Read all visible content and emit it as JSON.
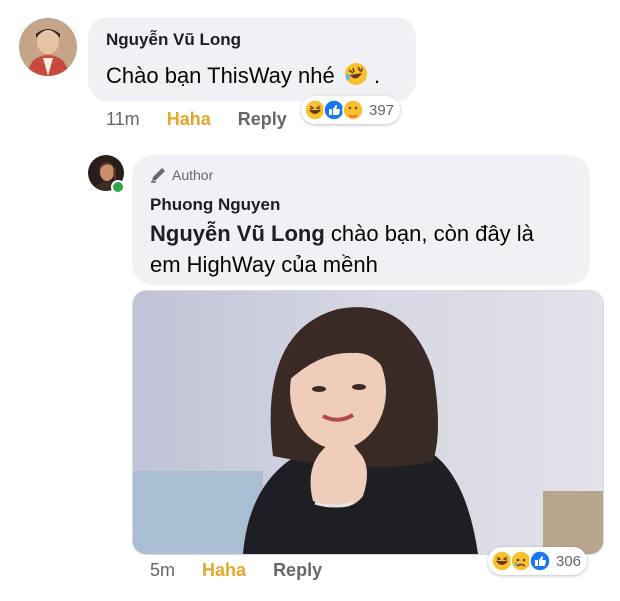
{
  "comment1": {
    "author": "Nguyễn Vũ Long",
    "text": "Chào bạn ThisWay nhé",
    "text_suffix": ".",
    "time": "11m",
    "reaction_label": "Haha",
    "reply_label": "Reply",
    "reaction_count": "397",
    "reactions": [
      "haha-icon",
      "like-icon",
      "care-icon"
    ]
  },
  "comment2": {
    "badge": "Author",
    "author": "Phuong Nguyen",
    "mention": "Nguyễn Vũ Long",
    "text_line1": " chào bạn, còn đây là",
    "text_line2": "em HighWay của mềnh",
    "time": "5m",
    "reaction_label": "Haha",
    "reply_label": "Reply",
    "reaction_count": "306",
    "reactions": [
      "haha-icon",
      "sad-icon",
      "like-icon"
    ]
  },
  "colors": {
    "bubble": "#eff1f4",
    "haha": "#e5a82b",
    "meta": "#65676b",
    "like": "#1877f2",
    "online": "#31a24c"
  }
}
